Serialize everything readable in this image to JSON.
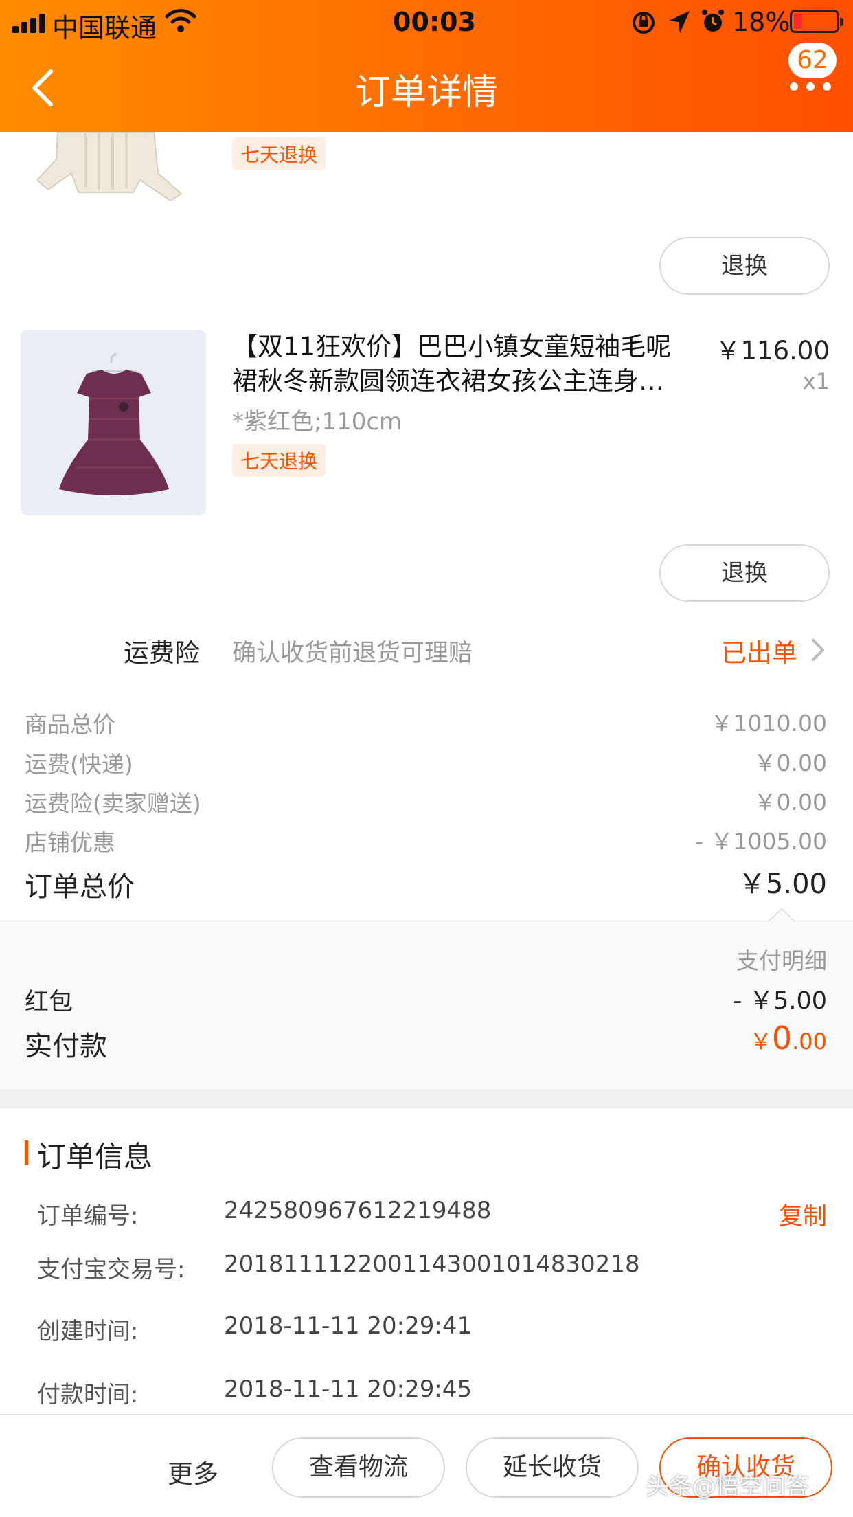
{
  "status_bar": {
    "carrier": "中国联通",
    "time": "00:03",
    "battery": "18%"
  },
  "header": {
    "title": "订单详情",
    "message_count": "62"
  },
  "colors": {
    "accent": "#ff5000",
    "header_gradient_start": "#ff8c00",
    "header_gradient_end": "#ff4f00"
  },
  "products": [
    {
      "tag": "七天退换",
      "action": "退换"
    },
    {
      "title_line1": "【双11狂欢价】巴巴小镇女童短袖毛呢",
      "title_line2": "裙秋冬新款圆领连衣裙女孩公主连身…",
      "variant": "*紫红色;110cm",
      "tag": "七天退换",
      "price": "￥116.00",
      "quantity": "x1",
      "action": "退换"
    }
  ],
  "shipping_insurance": {
    "label": "运费险",
    "description": "确认收货前退货可理赔",
    "status": "已出单"
  },
  "price_summary": [
    {
      "label": "商品总价",
      "value": "￥1010.00"
    },
    {
      "label": "运费(快递)",
      "value": "￥0.00"
    },
    {
      "label": "运费险(卖家赠送)",
      "value": "￥0.00"
    },
    {
      "label": "店铺优惠",
      "value": "- ￥1005.00"
    }
  ],
  "order_total": {
    "label": "订单总价",
    "value": "￥5.00"
  },
  "payment": {
    "detail_label": "支付明细",
    "red_packet_label": "红包",
    "red_packet_value": "- ￥5.00",
    "paid_label": "实付款",
    "paid_currency": "￥",
    "paid_integer": "0",
    "paid_decimal": ".00"
  },
  "order_info": {
    "section_title": "订单信息",
    "copy_label": "复制",
    "rows": [
      {
        "label": "订单编号:",
        "value": "242580967612219488"
      },
      {
        "label": "支付宝交易号:",
        "value": "2018111122001143001014830218"
      },
      {
        "label": "创建时间:",
        "value": "2018-11-11 20:29:41"
      },
      {
        "label": "付款时间:",
        "value": "2018-11-11 20:29:45"
      }
    ]
  },
  "bottom_bar": {
    "more": "更多",
    "view_logistics": "查看物流",
    "extend_receipt": "延长收货",
    "confirm_receipt": "确认收货"
  },
  "watermark": "头条@悟空问答"
}
